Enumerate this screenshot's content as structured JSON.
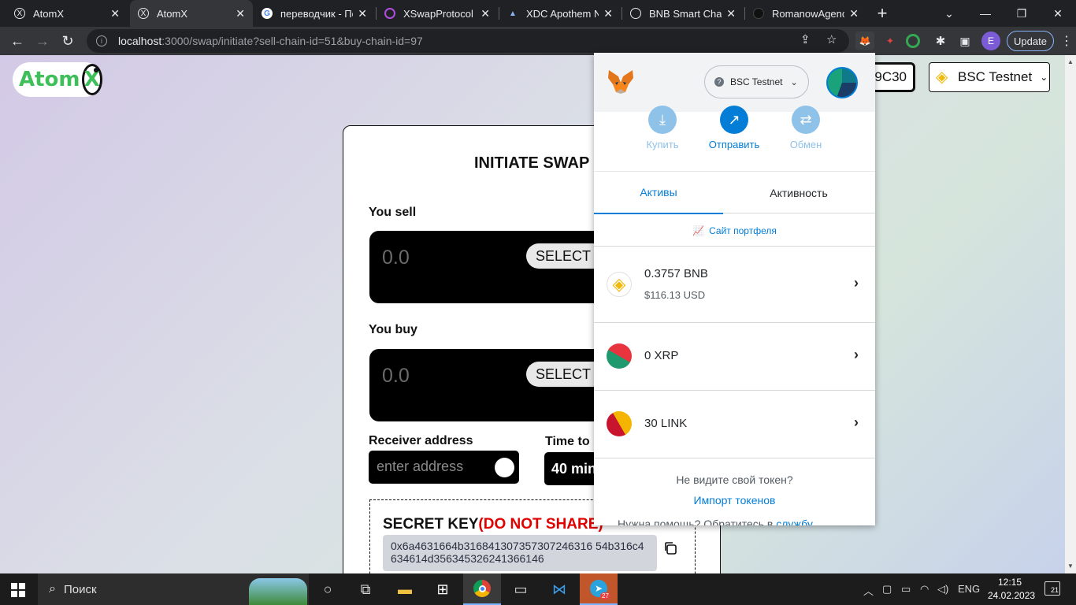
{
  "browser": {
    "tabs": [
      {
        "title": "AtomX",
        "icon": "atomx-favicon",
        "active": false
      },
      {
        "title": "AtomX",
        "icon": "atomx-favicon",
        "active": true
      },
      {
        "title": "переводчик - По",
        "icon": "google-favicon",
        "active": false
      },
      {
        "title": "XSwapProtocol",
        "icon": "xswap-favicon",
        "active": false
      },
      {
        "title": "XDC Apothem Ne",
        "icon": "xdc-favicon",
        "active": false
      },
      {
        "title": "BNB Smart Chain",
        "icon": "globe-favicon",
        "active": false
      },
      {
        "title": "RomanowAgency",
        "icon": "github-favicon",
        "active": false
      }
    ],
    "url_host": "localhost",
    "url_rest": ":3000/swap/initiate?sell-chain-id=51&buy-chain-id=97",
    "profile_initial": "E",
    "update_label": "Update"
  },
  "app": {
    "logo_text": "Atom",
    "logo_x": "X",
    "wallet_addr_suffix": "9C30",
    "chain_name": "BSC Testnet"
  },
  "swap": {
    "title": "INITIATE SWAP",
    "sell_label": "You sell",
    "sell_value": "0.0",
    "sell_select": "SELECT",
    "buy_label": "You buy",
    "buy_value": "0.0",
    "buy_select": "SELECT",
    "receiver_label": "Receiver address",
    "receiver_placeholder": "enter address",
    "time_label": "Time to l",
    "time_value": "40 min",
    "secret_title": "SECRET KEY",
    "secret_warning": "(DO NOT SHARE)",
    "secret_value": "0x6a4631664b316841307357307246316 54b316c4634614d356345326241366146"
  },
  "metamask": {
    "network": "BSC Testnet",
    "actions": [
      {
        "label": "Купить",
        "icon": "download-icon",
        "color": "#8fc2e8",
        "text_color": "#8fc2e8"
      },
      {
        "label": "Отправить",
        "icon": "send-arrow-icon",
        "color": "#037dd6",
        "text_color": "#037dd6"
      },
      {
        "label": "Обмен",
        "icon": "swap-icon",
        "color": "#8fc2e8",
        "text_color": "#8fc2e8"
      }
    ],
    "tabs": [
      "Активы",
      "Активность"
    ],
    "portfolio_link": "Сайт портфеля",
    "assets": [
      {
        "amount": "0.3757 BNB",
        "usd": "$116.13 USD"
      },
      {
        "amount": "0 XRP",
        "usd": ""
      },
      {
        "amount": "30 LINK",
        "usd": ""
      }
    ],
    "missing_token": "Не видите свой токен?",
    "import_tokens": "Импорт токенов",
    "help_text": "Нужна помощь? Обратитесь в ",
    "help_link": "службу"
  },
  "taskbar": {
    "search_placeholder": "Поиск",
    "lang": "ENG",
    "time": "12:15",
    "date": "24.02.2023",
    "notif_count": "21",
    "telegram_badge": "27"
  },
  "colors": {
    "metamask_blue": "#037dd6",
    "warning_red": "#e00000",
    "atomx_green": "#3fbf5a",
    "bnb_yellow": "#f0b90b"
  }
}
